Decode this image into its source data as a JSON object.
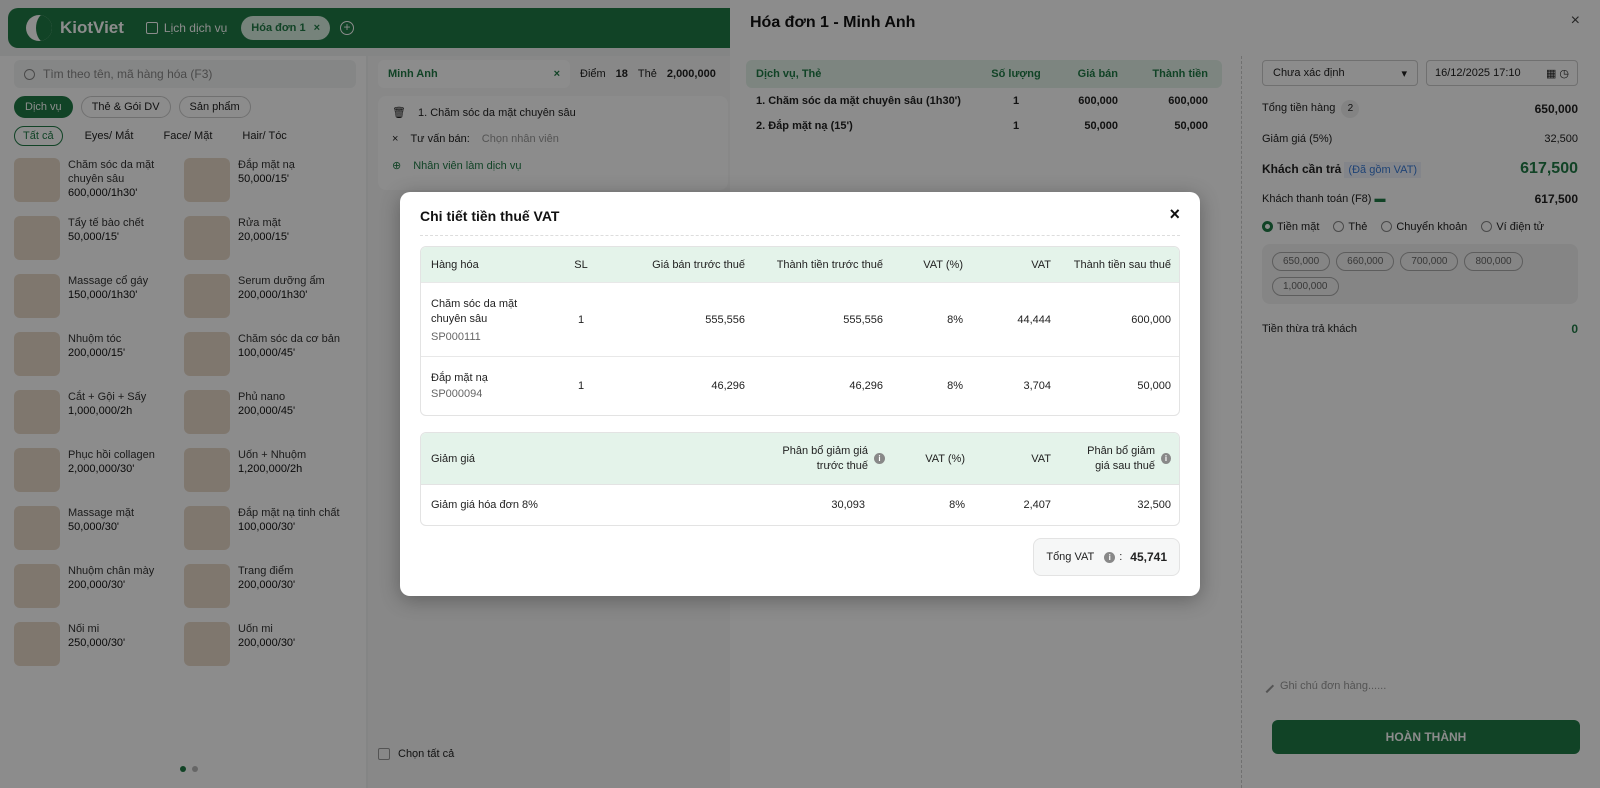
{
  "app": {
    "brand": "KiotViet",
    "nav_service_calendar": "Lịch dịch vụ",
    "active_tab": "Hóa đơn 1"
  },
  "left": {
    "search_placeholder": "Tìm theo tên, mã hàng hóa (F3)",
    "categories": [
      "Dịch vụ",
      "Thẻ & Gói DV",
      "Sản phẩm"
    ],
    "subcategories": [
      "Tất cả",
      "Eyes/ Mắt",
      "Face/ Mặt",
      "Hair/ Tóc"
    ],
    "products": [
      {
        "name": "Chăm sóc da mặt chuyên sâu",
        "price": "600,000/1h30'"
      },
      {
        "name": "Đắp mặt nạ",
        "price": "50,000/15'"
      },
      {
        "name": "Tẩy tế bào chết",
        "price": "50,000/15'"
      },
      {
        "name": "Rửa mặt",
        "price": "20,000/15'"
      },
      {
        "name": "Massage cổ gáy",
        "price": "150,000/1h30'"
      },
      {
        "name": "Serum dưỡng ẩm",
        "price": "200,000/1h30'"
      },
      {
        "name": "Nhuộm tóc",
        "price": "200,000/15'"
      },
      {
        "name": "Chăm sóc da cơ bản",
        "price": "100,000/45'"
      },
      {
        "name": "Cắt + Gội + Sấy",
        "price": "1,000,000/2h"
      },
      {
        "name": "Phủ nano",
        "price": "200,000/45'"
      },
      {
        "name": "Phục hồi collagen",
        "price": "2,000,000/30'"
      },
      {
        "name": "Uốn + Nhuộm",
        "price": "1,200,000/2h"
      },
      {
        "name": "Massage mặt",
        "price": "50,000/30'"
      },
      {
        "name": "Đắp mặt nạ tinh chất",
        "price": "100,000/30'"
      },
      {
        "name": "Nhuộm chân mày",
        "price": "200,000/30'"
      },
      {
        "name": "Trang điểm",
        "price": "200,000/30'"
      },
      {
        "name": "Nối mi",
        "price": "250,000/30'"
      },
      {
        "name": "Uốn mi",
        "price": "200,000/30'"
      }
    ]
  },
  "middle": {
    "customer": "Minh Anh",
    "points_label": "Điểm",
    "points": "18",
    "card_label": "Thẻ",
    "card_value": "2,000,000",
    "service_line": "1.   Chăm sóc da mặt chuyên sâu",
    "consultant_label": "Tư vấn bán:",
    "consultant_placeholder": "Chọn nhân viên",
    "add_staff": "Nhân viên làm dịch vụ",
    "select_all": "Chọn tất cả"
  },
  "drawer": {
    "title": "Hóa đơn 1 - Minh Anh",
    "table_headers": [
      "Dịch vụ, Thẻ",
      "Số lượng",
      "Giá bán",
      "Thành tiền"
    ],
    "items": [
      {
        "name": "1.   Chăm sóc da mặt chuyên sâu (1h30')",
        "qty": "1",
        "price": "600,000",
        "total": "600,000"
      },
      {
        "name": "2.   Đắp mặt nạ (15')",
        "qty": "1",
        "price": "50,000",
        "total": "50,000"
      }
    ],
    "status_select": "Chưa xác định",
    "datetime": "16/12/2025 17:10",
    "total_goods_label": "Tổng tiền hàng",
    "total_goods_count": "2",
    "total_goods": "650,000",
    "discount_label": "Giảm giá (5%)",
    "discount": "32,500",
    "customer_pays_label": "Khách cần trả",
    "vat_included": "(Đã gồm VAT)",
    "customer_pays": "617,500",
    "customer_paid_label": "Khách thanh toán (F8)",
    "customer_paid": "617,500",
    "payment_methods": [
      "Tiền mặt",
      "Thẻ",
      "Chuyển khoản",
      "Ví điện tử"
    ],
    "quick_amounts": [
      "650,000",
      "660,000",
      "700,000",
      "800,000",
      "1,000,000"
    ],
    "change_label": "Tiền thừa trả khách",
    "change": "0",
    "note_placeholder": "Ghi chú đơn hàng......",
    "complete_button": "HOÀN THÀNH"
  },
  "modal": {
    "title": "Chi tiết tiền thuế VAT",
    "headers": [
      "Hàng hóa",
      "SL",
      "Giá bán trước thuế",
      "Thành tiền trước thuế",
      "VAT (%)",
      "VAT",
      "Thành tiền sau thuế"
    ],
    "rows": [
      {
        "name": "Chăm sóc da mặt chuyên sâu",
        "code": "SP000111",
        "qty": "1",
        "unit_before": "555,556",
        "total_before": "555,556",
        "vat_pct": "8%",
        "vat": "44,444",
        "total_after": "600,000"
      },
      {
        "name": "Đắp mặt nạ",
        "code": "SP000094",
        "qty": "1",
        "unit_before": "46,296",
        "total_before": "46,296",
        "vat_pct": "8%",
        "vat": "3,704",
        "total_after": "50,000"
      }
    ],
    "discount_headers": [
      "Giảm giá",
      "Phân bổ giảm giá trước thuế",
      "VAT (%)",
      "VAT",
      "Phân bổ giảm giá sau thuế"
    ],
    "discount_row": {
      "name": "Giảm giá hóa đơn 8%",
      "before": "30,093",
      "vat_pct": "8%",
      "vat": "2,407",
      "after": "32,500"
    },
    "total_vat_label": "Tổng VAT",
    "total_vat": "45,741"
  }
}
